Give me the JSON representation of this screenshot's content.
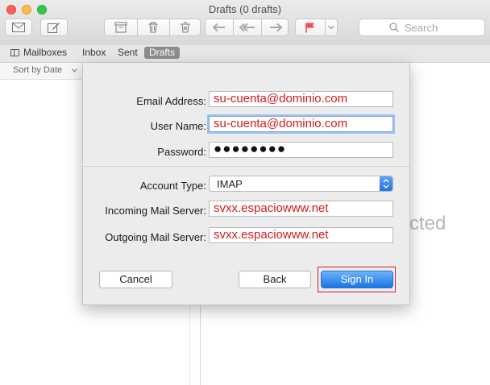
{
  "window": {
    "title": "Drafts (0 drafts)"
  },
  "toolbar": {
    "icons": [
      "get-mail-icon",
      "compose-icon",
      "archive-icon",
      "trash-icon",
      "junk-icon",
      "reply-icon",
      "reply-all-icon",
      "forward-icon",
      "flag-icon",
      "chevron-down-icon"
    ],
    "search_placeholder": "Search"
  },
  "favorites": {
    "mailboxes_label": "Mailboxes",
    "items": [
      {
        "label": "Inbox"
      },
      {
        "label": "Sent"
      },
      {
        "label": "Drafts",
        "active": true
      }
    ]
  },
  "message_list": {
    "sort_label": "Sort by Date"
  },
  "viewer": {
    "partial_text": "cted"
  },
  "account_sheet": {
    "email_label": "Email Address:",
    "email_value": "su-cuenta@dominio.com",
    "username_label": "User Name:",
    "username_value": "su-cuenta@dominio.com",
    "password_label": "Password:",
    "password_value": "●●●●●●●●",
    "account_type_label": "Account Type:",
    "account_type_value": "IMAP",
    "incoming_label": "Incoming Mail Server:",
    "incoming_value": "svxx.espaciowww.net",
    "outgoing_label": "Outgoing Mail Server:",
    "outgoing_value": "svxx.espaciowww.net",
    "cancel_label": "Cancel",
    "back_label": "Back",
    "signin_label": "Sign In"
  },
  "colors": {
    "field_text": "#d41a1a",
    "primary_button": "#1a74e8",
    "highlight_box": "#d42424"
  }
}
